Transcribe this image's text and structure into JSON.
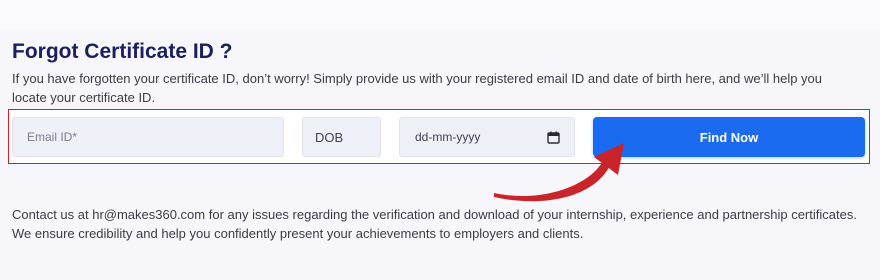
{
  "heading": {
    "title": "Forgot Certificate ID ?",
    "description": "If you have forgotten your certificate ID, don’t worry! Simply provide us with your registered email ID and date of birth here, and we’ll help you locate your certificate ID."
  },
  "form": {
    "email_placeholder": "Email ID*",
    "email_value": "",
    "dob_label": "DOB",
    "date_placeholder": "dd-mm-yyyy",
    "submit_label": "Find Now"
  },
  "icons": {
    "calendar": "calendar-icon",
    "arrow": "curved-arrow-icon"
  },
  "footer": {
    "contact_text": "Contact us at hr@makes360.com for any issues regarding the verification and download of your internship, experience and partnership certificates. We ensure credibility and help you confidently present your achievements to employers and clients."
  },
  "colors": {
    "title": "#1b1f5e",
    "button": "#1a6bf0",
    "highlight_border": "#c8242a",
    "arrow": "#c8242a"
  }
}
